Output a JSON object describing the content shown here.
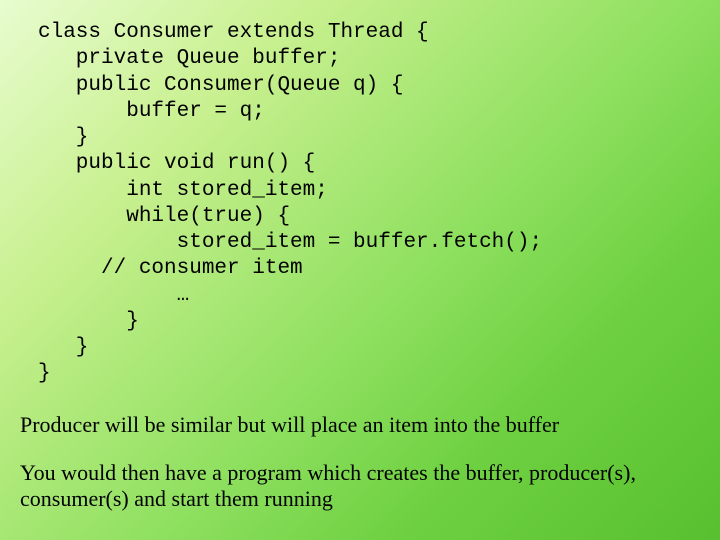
{
  "code": {
    "l1": "class Consumer extends Thread {",
    "l2": "   private Queue buffer;",
    "l3": "   public Consumer(Queue q) {",
    "l4": "       buffer = q;",
    "l5": "   }",
    "l6": "   public void run() {",
    "l7": "       int stored_item;",
    "l8": "       while(true) {",
    "l9": "           stored_item = buffer.fetch();",
    "l10": "     // consumer item",
    "l11": "           …",
    "l12": "       }",
    "l13": "   }",
    "l14": "}"
  },
  "prose": {
    "p1": "Producer will be similar but will place an item into the buffer",
    "p2": "You would then have a program which creates the buffer, producer(s), consumer(s) and start them running"
  }
}
